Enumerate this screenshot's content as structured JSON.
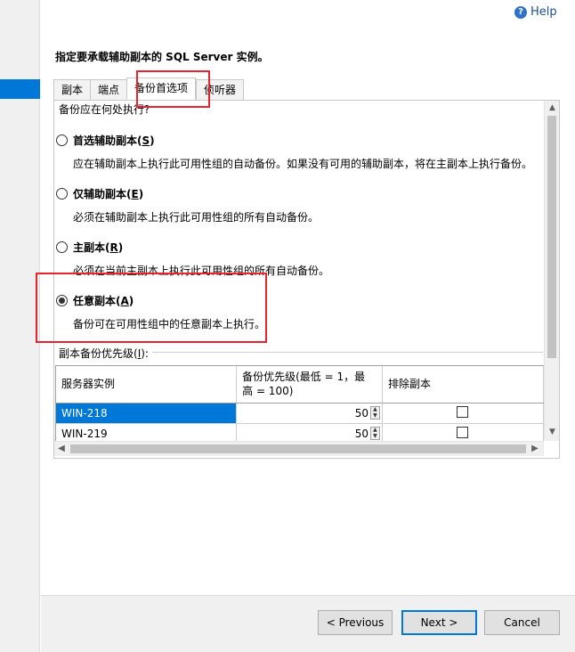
{
  "help": {
    "label": "Help"
  },
  "instruction": "指定要承载辅助副本的 SQL Server 实例。",
  "tabs": [
    {
      "label": "副本"
    },
    {
      "label": "端点"
    },
    {
      "label": "备份首选项"
    },
    {
      "label": "侦听器"
    }
  ],
  "active_tab": "备份首选项",
  "question": "备份应在何处执行?",
  "options": [
    {
      "label": "首选辅助副本",
      "mnemonic": "S",
      "description": "应在辅助副本上执行此可用性组的自动备份。如果没有可用的辅助副本，将在主副本上执行备份。",
      "selected": false
    },
    {
      "label": "仅辅助副本",
      "mnemonic": "E",
      "description": "必须在辅助副本上执行此可用性组的所有自动备份。",
      "selected": false
    },
    {
      "label": "主副本",
      "mnemonic": "R",
      "description": "必须在当前主副本上执行此可用性组的所有自动备份。",
      "selected": false
    },
    {
      "label": "任意副本",
      "mnemonic": "A",
      "description": "备份可在可用性组中的任意副本上执行。",
      "selected": true
    }
  ],
  "priority_group": {
    "label": "副本备份优先级(",
    "mnemonic": "I",
    "suffix": "):"
  },
  "grid": {
    "headers": {
      "server": "服务器实例",
      "priority_line1": "备份优先级(最低 = 1，最",
      "priority_line2": "高 = 100)",
      "exclude": "排除副本"
    },
    "rows": [
      {
        "server": "WIN-218",
        "priority": "50",
        "exclude": false
      },
      {
        "server": "WIN-219",
        "priority": "50",
        "exclude": false
      }
    ]
  },
  "buttons": {
    "previous": "< Previous",
    "next": "Next >",
    "cancel": "Cancel"
  },
  "colors": {
    "selection": "#0078d7",
    "annotation": "#e8252e"
  }
}
